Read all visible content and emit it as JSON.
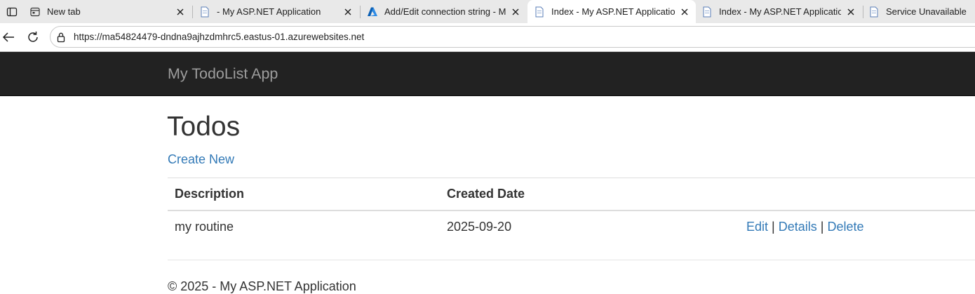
{
  "browser": {
    "tabs": [
      {
        "title": "New tab",
        "icon": "new-tab-icon",
        "active": false
      },
      {
        "title": "- My ASP.NET Application",
        "icon": "page-icon",
        "active": false
      },
      {
        "title": "Add/Edit connection string - Microsoft Azure",
        "icon": "azure-icon",
        "active": false
      },
      {
        "title": "Index - My ASP.NET Application",
        "icon": "page-icon",
        "active": true
      },
      {
        "title": "Index - My ASP.NET Application",
        "icon": "page-icon",
        "active": false
      },
      {
        "title": "Service Unavailable",
        "icon": "page-icon",
        "active": false
      }
    ],
    "url": "https://ma54824479-dndna9ajhzdmhrc5.eastus-01.azurewebsites.net"
  },
  "site": {
    "brand": "My TodoList App",
    "page_title": "Todos",
    "create_new": "Create New",
    "table": {
      "headers": [
        "Description",
        "Created Date"
      ],
      "rows": [
        {
          "description": "my routine",
          "created_date": "2025-09-20",
          "actions": {
            "edit": "Edit",
            "details": "Details",
            "delete": "Delete",
            "separator": "|"
          }
        }
      ]
    },
    "footer": "© 2025 - My ASP.NET Application"
  },
  "colors": {
    "navbar_bg": "#222222",
    "brand_text": "#9d9d9d",
    "link": "#337ab7",
    "text": "#333333"
  }
}
